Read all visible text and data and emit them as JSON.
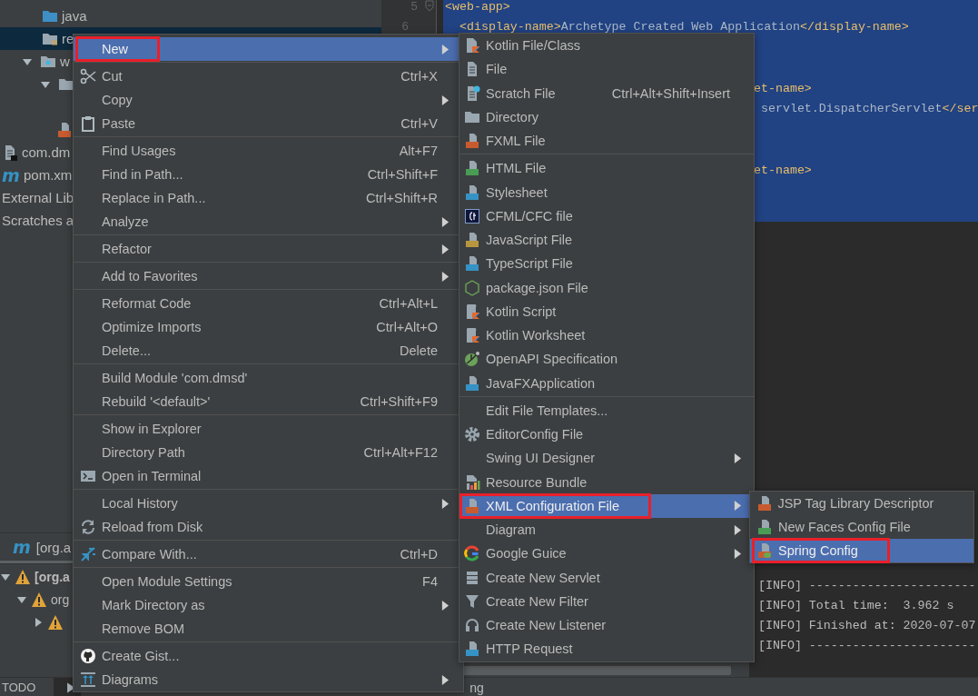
{
  "project_tree": {
    "items": [
      {
        "label": "java",
        "kind": "source-folder",
        "selected": false
      },
      {
        "label": "re",
        "kind": "resources-folder",
        "selected": true
      },
      {
        "label": "w",
        "kind": "web-folder",
        "selected": false,
        "expanded": true,
        "children": [
          {
            "kind": "folder",
            "selected": false,
            "expanded": true,
            "children": [
              {
                "kind": "js-file",
                "selected": false
              }
            ]
          }
        ]
      }
    ],
    "root_items": [
      {
        "label": "com.dm",
        "kind": "module-file",
        "selected": false
      },
      {
        "label": "pom.xm",
        "kind": "maven",
        "icon_text": "m",
        "selected": false
      },
      {
        "label": "External Lib",
        "kind": "plain",
        "selected": false
      },
      {
        "label": "Scratches a",
        "kind": "plain",
        "selected": false
      }
    ]
  },
  "editor": {
    "lines": [
      {
        "number": "5",
        "kind": "full",
        "fold": true,
        "segments": [
          {
            "kind": "tag",
            "text": "<web-app>"
          }
        ]
      },
      {
        "number": "6",
        "kind": "indented",
        "segments": [
          {
            "kind": "tag",
            "text": "<display-name>"
          },
          {
            "kind": "text",
            "text": "Archetype Created Web Application"
          },
          {
            "kind": "tag",
            "text": "</display-name>"
          }
        ]
      },
      {
        "kind": "blank"
      },
      {
        "kind": "blank"
      },
      {
        "kind": "tail",
        "segments": [
          {
            "kind": "tag",
            "text": "et-name>"
          }
        ]
      },
      {
        "kind": "tail",
        "segments": [
          {
            "kind": "text",
            "text": " servlet.DispatcherServlet"
          },
          {
            "kind": "tag",
            "text": "</ser"
          }
        ]
      },
      {
        "kind": "blank"
      },
      {
        "kind": "blank"
      },
      {
        "kind": "tail",
        "segments": [
          {
            "kind": "tag",
            "text": "et-name>"
          }
        ]
      },
      {
        "kind": "blank"
      },
      {
        "kind": "blank"
      }
    ]
  },
  "run_panel": {
    "tab": {
      "icon_text": "m",
      "label": "[org.a",
      "selected": true
    },
    "tree": [
      {
        "label": "[org.a",
        "warning": true,
        "expanded": true,
        "children": [
          {
            "label": "org",
            "warning": true,
            "expanded": true,
            "children": [
              {
                "warning": true,
                "expanded": false
              }
            ]
          }
        ]
      }
    ],
    "console": [
      "[INFO] -----------------------",
      "[INFO] Total time:  3.962 s",
      "[INFO] Finished at: 2020-07-07",
      "[INFO] -----------------------"
    ]
  },
  "bottom_bar": {
    "tabs": [
      {
        "kind": "text",
        "label": "TODO",
        "selected": false
      },
      {
        "kind": "run",
        "selected": true
      }
    ],
    "status": "ng"
  },
  "context_menu": {
    "items": [
      {
        "kind": "plain",
        "label": "New",
        "submenu": true,
        "selected": true,
        "annotated": true
      },
      {
        "kind": "separator"
      },
      {
        "kind": "cut",
        "label": "Cut",
        "shortcut": "Ctrl+X",
        "submenu": false,
        "selected": false,
        "annotated": false
      },
      {
        "kind": "plain",
        "label": "Copy",
        "submenu": true,
        "selected": false,
        "annotated": false
      },
      {
        "kind": "paste",
        "label": "Paste",
        "shortcut": "Ctrl+V",
        "submenu": false,
        "selected": false,
        "annotated": false
      },
      {
        "kind": "separator"
      },
      {
        "kind": "plain",
        "label": "Find Usages",
        "shortcut": "Alt+F7",
        "submenu": false,
        "selected": false,
        "annotated": false
      },
      {
        "kind": "plain",
        "label": "Find in Path...",
        "shortcut": "Ctrl+Shift+F",
        "submenu": false,
        "selected": false,
        "annotated": false
      },
      {
        "kind": "plain",
        "label": "Replace in Path...",
        "shortcut": "Ctrl+Shift+R",
        "submenu": false,
        "selected": false,
        "annotated": false
      },
      {
        "kind": "plain",
        "label": "Analyze",
        "submenu": true,
        "selected": false,
        "annotated": false
      },
      {
        "kind": "separator"
      },
      {
        "kind": "plain",
        "label": "Refactor",
        "submenu": true,
        "selected": false,
        "annotated": false
      },
      {
        "kind": "separator"
      },
      {
        "kind": "plain",
        "label": "Add to Favorites",
        "submenu": true,
        "selected": false,
        "annotated": false
      },
      {
        "kind": "separator"
      },
      {
        "kind": "plain",
        "label": "Reformat Code",
        "shortcut": "Ctrl+Alt+L",
        "submenu": false,
        "selected": false,
        "annotated": false
      },
      {
        "kind": "plain",
        "label": "Optimize Imports",
        "shortcut": "Ctrl+Alt+O",
        "submenu": false,
        "selected": false,
        "annotated": false
      },
      {
        "kind": "plain",
        "label": "Delete...",
        "shortcut": "Delete",
        "submenu": false,
        "selected": false,
        "annotated": false
      },
      {
        "kind": "separator"
      },
      {
        "kind": "plain",
        "label": "Build Module 'com.dmsd'",
        "submenu": false,
        "selected": false,
        "annotated": false
      },
      {
        "kind": "plain",
        "label": "Rebuild '<default>'",
        "shortcut": "Ctrl+Shift+F9",
        "submenu": false,
        "selected": false,
        "annotated": false
      },
      {
        "kind": "separator"
      },
      {
        "kind": "plain",
        "label": "Show in Explorer",
        "submenu": false,
        "selected": false,
        "annotated": false
      },
      {
        "kind": "plain",
        "label": "Directory Path",
        "shortcut": "Ctrl+Alt+F12",
        "submenu": false,
        "selected": false,
        "annotated": false
      },
      {
        "kind": "terminal",
        "label": "Open in Terminal",
        "submenu": false,
        "selected": false,
        "annotated": false
      },
      {
        "kind": "separator"
      },
      {
        "kind": "plain",
        "label": "Local History",
        "submenu": true,
        "selected": false,
        "annotated": false
      },
      {
        "kind": "reload",
        "label": "Reload from Disk",
        "submenu": false,
        "selected": false,
        "annotated": false
      },
      {
        "kind": "separator"
      },
      {
        "kind": "compare",
        "label": "Compare With...",
        "shortcut": "Ctrl+D",
        "submenu": false,
        "selected": false,
        "annotated": false
      },
      {
        "kind": "separator"
      },
      {
        "kind": "plain",
        "label": "Open Module Settings",
        "shortcut": "F4",
        "submenu": false,
        "selected": false,
        "annotated": false
      },
      {
        "kind": "plain",
        "label": "Mark Directory as",
        "submenu": true,
        "selected": false,
        "annotated": false
      },
      {
        "kind": "plain",
        "label": "Remove BOM",
        "submenu": false,
        "selected": false,
        "annotated": false
      },
      {
        "kind": "separator"
      },
      {
        "kind": "github",
        "label": "Create Gist...",
        "submenu": false,
        "selected": false,
        "annotated": false
      },
      {
        "kind": "diagrams",
        "label": "Diagrams",
        "submenu": true,
        "selected": false,
        "annotated": false
      }
    ]
  },
  "new_submenu": {
    "items": [
      {
        "kind": "kotlin",
        "label": "Kotlin File/Class",
        "submenu": false,
        "selected": false,
        "annotated": false
      },
      {
        "kind": "file",
        "label": "File",
        "submenu": false,
        "selected": false,
        "annotated": false
      },
      {
        "kind": "scratch",
        "label": "Scratch File",
        "shortcut": "Ctrl+Alt+Shift+Insert",
        "submenu": false,
        "selected": false,
        "annotated": false
      },
      {
        "kind": "folder",
        "label": "Directory",
        "submenu": false,
        "selected": false,
        "annotated": false
      },
      {
        "kind": "fxml",
        "label": "FXML File",
        "submenu": false,
        "selected": false,
        "annotated": false
      },
      {
        "kind": "separator"
      },
      {
        "kind": "html",
        "label": "HTML File",
        "submenu": false,
        "selected": false,
        "annotated": false
      },
      {
        "kind": "css",
        "label": "Stylesheet",
        "submenu": false,
        "selected": false,
        "annotated": false
      },
      {
        "kind": "cfml",
        "label": "CFML/CFC file",
        "submenu": false,
        "selected": false,
        "annotated": false
      },
      {
        "kind": "js",
        "label": "JavaScript File",
        "submenu": false,
        "selected": false,
        "annotated": false
      },
      {
        "kind": "ts",
        "label": "TypeScript File",
        "submenu": false,
        "selected": false,
        "annotated": false
      },
      {
        "kind": "nodejs",
        "label": "package.json File",
        "submenu": false,
        "selected": false,
        "annotated": false
      },
      {
        "kind": "kotlin-script",
        "label": "Kotlin Script",
        "submenu": false,
        "selected": false,
        "annotated": false
      },
      {
        "kind": "kotlin-script",
        "label": "Kotlin Worksheet",
        "submenu": false,
        "selected": false,
        "annotated": false
      },
      {
        "kind": "openapi",
        "label": "OpenAPI Specification",
        "submenu": false,
        "selected": false,
        "annotated": false
      },
      {
        "kind": "javafx",
        "label": "JavaFXApplication",
        "submenu": false,
        "selected": false,
        "annotated": false
      },
      {
        "kind": "separator"
      },
      {
        "kind": "plain",
        "label": "Edit File Templates...",
        "submenu": false,
        "selected": false,
        "annotated": false
      },
      {
        "kind": "gear",
        "label": "EditorConfig File",
        "submenu": false,
        "selected": false,
        "annotated": false
      },
      {
        "kind": "plain",
        "label": "Swing UI Designer",
        "submenu": true,
        "selected": false,
        "annotated": false
      },
      {
        "kind": "resource-bundle",
        "label": "Resource Bundle",
        "submenu": false,
        "selected": false,
        "annotated": false
      },
      {
        "kind": "xml",
        "label": "XML Configuration File",
        "submenu": true,
        "selected": true,
        "annotated": true
      },
      {
        "kind": "plain",
        "label": "Diagram",
        "submenu": true,
        "selected": false,
        "annotated": false
      },
      {
        "kind": "google",
        "label": "Google Guice",
        "submenu": true,
        "selected": false,
        "annotated": false
      },
      {
        "kind": "servlet",
        "label": "Create New Servlet",
        "submenu": false,
        "selected": false,
        "annotated": false
      },
      {
        "kind": "filter",
        "label": "Create New Filter",
        "submenu": false,
        "selected": false,
        "annotated": false
      },
      {
        "kind": "listener",
        "label": "Create New Listener",
        "submenu": false,
        "selected": false,
        "annotated": false
      },
      {
        "kind": "api",
        "label": "HTTP Request",
        "submenu": false,
        "selected": false,
        "annotated": false
      }
    ]
  },
  "xml_submenu": {
    "items": [
      {
        "kind": "jsp-tld",
        "label": "JSP Tag Library Descriptor",
        "submenu": false,
        "selected": false,
        "annotated": false
      },
      {
        "kind": "jsf",
        "label": "New Faces Config File",
        "submenu": false,
        "selected": false,
        "annotated": false
      },
      {
        "kind": "spring",
        "label": "Spring Config",
        "submenu": false,
        "selected": true,
        "annotated": true
      }
    ]
  }
}
